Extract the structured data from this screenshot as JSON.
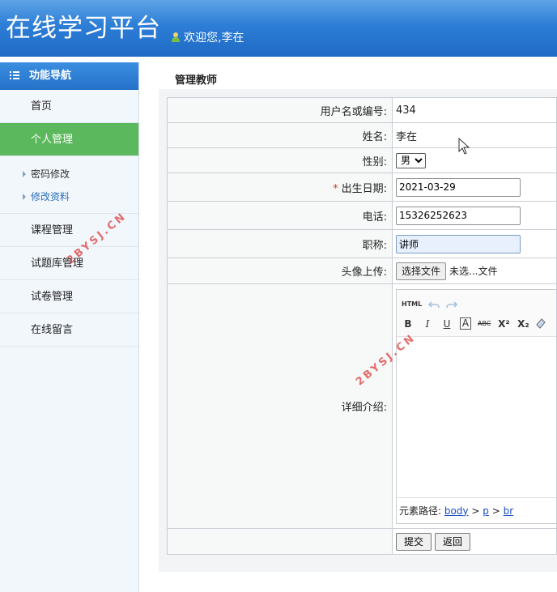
{
  "header": {
    "title": "在线学习平台",
    "welcome": "欢迎您,李在"
  },
  "sidebar": {
    "nav_title": "功能导航",
    "items": [
      {
        "label": "首页"
      },
      {
        "label": "个人管理"
      },
      {
        "label": "课程管理"
      },
      {
        "label": "试题库管理"
      },
      {
        "label": "试卷管理"
      },
      {
        "label": "在线留言"
      }
    ],
    "sub_items": [
      {
        "label": "密码修改"
      },
      {
        "label": "修改资料"
      }
    ]
  },
  "page": {
    "title": "管理教师"
  },
  "form": {
    "username_label": "用户名或编号:",
    "username_value": "434",
    "name_label": "姓名:",
    "name_value": "李在",
    "gender_label": "性别:",
    "gender_value": "男",
    "required_mark": "*",
    "birth_label": "出生日期:",
    "birth_value": "2021-03-29",
    "phone_label": "电话:",
    "phone_value": "15326252623",
    "title_label": "职称:",
    "title_value": "讲师",
    "avatar_label": "头像上传:",
    "file_button": "选择文件",
    "file_status": "未选...文件",
    "intro_label": "详细介绍:",
    "path_label": "元素路径:",
    "path_body": "body",
    "path_p": "p",
    "path_br": "br",
    "path_sep": ">",
    "submit_label": "提交",
    "back_label": "返回"
  },
  "editor_toolbar": {
    "html": "HTML",
    "bold": "B",
    "italic": "I",
    "underline": "U",
    "font_color": "A",
    "strike": "ABC",
    "sup": "X²",
    "sub": "X₂"
  },
  "watermark": "2BYSJ.CN",
  "colors": {
    "header": "#2a7ad4",
    "active_menu": "#5cb85c",
    "link": "#2a6fb8"
  }
}
